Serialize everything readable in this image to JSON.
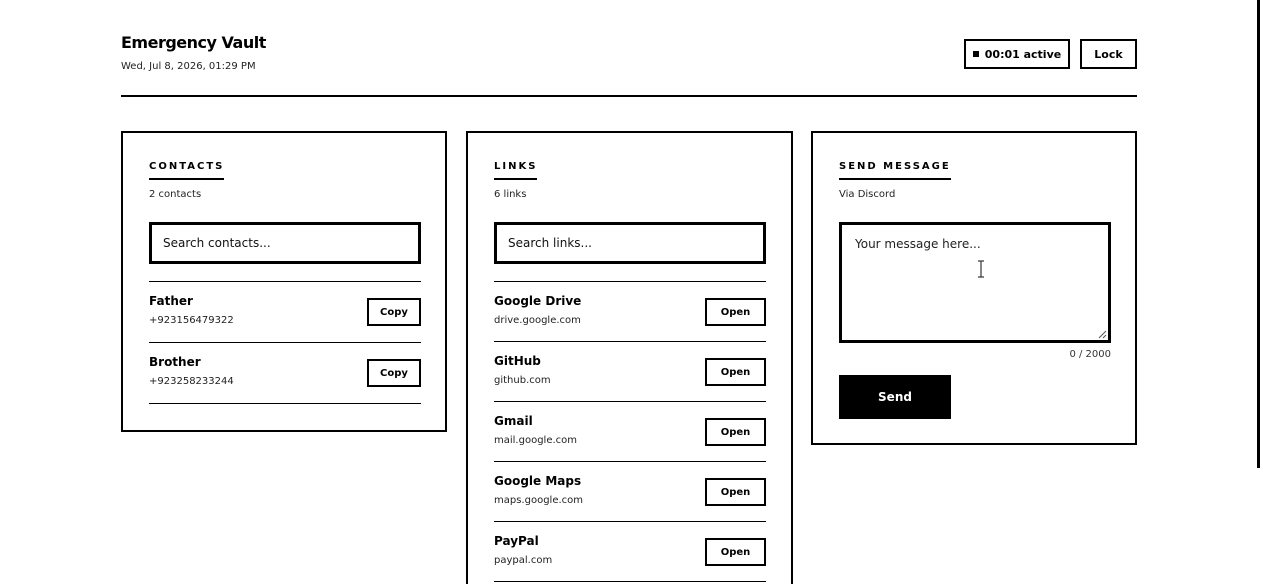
{
  "header": {
    "title": "Emergency Vault",
    "datetime": "Wed, Jul 8, 2026, 01:29 PM",
    "timer_label": "00:01 active",
    "lock_label": "Lock"
  },
  "contacts": {
    "title": "CONTACTS",
    "subtitle": "2 contacts",
    "search_placeholder": "Search contacts...",
    "items": [
      {
        "name": "Father",
        "phone": "+923156479322",
        "action": "Copy"
      },
      {
        "name": "Brother",
        "phone": "+923258233244",
        "action": "Copy"
      }
    ]
  },
  "links": {
    "title": "LINKS",
    "subtitle": "6 links",
    "search_placeholder": "Search links...",
    "items": [
      {
        "name": "Google Drive",
        "url": "drive.google.com",
        "action": "Open"
      },
      {
        "name": "GitHub",
        "url": "github.com",
        "action": "Open"
      },
      {
        "name": "Gmail",
        "url": "mail.google.com",
        "action": "Open"
      },
      {
        "name": "Google Maps",
        "url": "maps.google.com",
        "action": "Open"
      },
      {
        "name": "PayPal",
        "url": "paypal.com",
        "action": "Open"
      }
    ]
  },
  "message": {
    "title": "SEND MESSAGE",
    "subtitle": "Via Discord",
    "placeholder": "Your message here...",
    "value": "",
    "counter": "0 / 2000",
    "send_label": "Send"
  },
  "colors": {
    "foreground": "#000000",
    "background": "#ffffff"
  },
  "icons": [
    "stop-square-icon",
    "resize-grip-icon",
    "text-cursor-icon"
  ]
}
